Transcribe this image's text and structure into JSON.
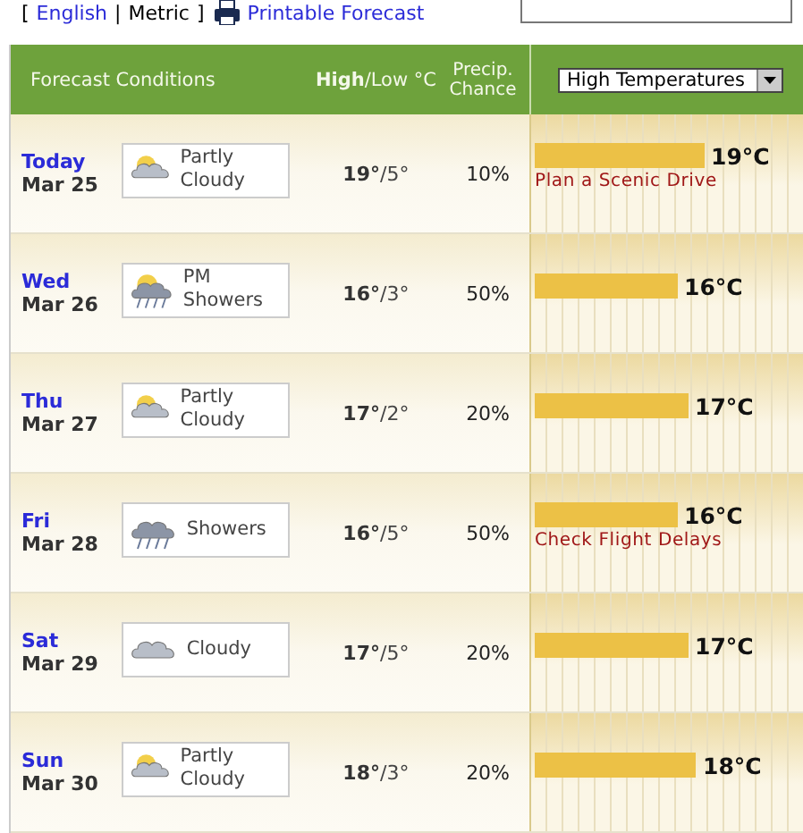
{
  "top_bar": {
    "open_bracket": "[",
    "units": [
      {
        "label": "English",
        "selected": false
      },
      {
        "label": "Metric",
        "selected": true
      }
    ],
    "separator": "|",
    "close_bracket": "]",
    "print_link": "Printable Forecast"
  },
  "header": {
    "conditions": "Forecast Conditions",
    "temps": "**High**/Low °C",
    "precip": "Precip. Chance",
    "chart_select": "High Temperatures"
  },
  "days": [
    {
      "day": "Today",
      "date": "Mar 25",
      "kind": "partly-cloudy",
      "condition": "Partly Cloudy",
      "high": "19°",
      "low": "/5°",
      "precip": "10%",
      "level": 0.63,
      "reading": "19°C",
      "note": "Plan a Scenic Drive"
    },
    {
      "day": "Wed",
      "date": "Mar 26",
      "kind": "showers",
      "condition": "PM Showers",
      "high": "16°",
      "low": "/3°",
      "precip": "50%",
      "level": 0.53,
      "reading": "16°C"
    },
    {
      "day": "Thu",
      "date": "Mar 27",
      "kind": "partly-cloudy",
      "condition": "Partly Cloudy",
      "high": "17°",
      "low": "/2°",
      "precip": "20%",
      "level": 0.57,
      "reading": "17°C"
    },
    {
      "day": "Fri",
      "date": "Mar 28",
      "kind": "showers",
      "condition": "Showers",
      "high": "16°",
      "low": "/5°",
      "precip": "50%",
      "level": 0.53,
      "reading": "16°C",
      "note": "Check Flight Delays"
    },
    {
      "day": "Sat",
      "date": "Mar 29",
      "kind": "cloudy",
      "condition": "Cloudy",
      "high": "17°",
      "low": "/5°",
      "precip": "20%",
      "level": 0.57,
      "reading": "17°C"
    },
    {
      "day": "Sun",
      "date": "Mar 30",
      "kind": "partly-cloudy",
      "condition": "Partly Cloudy",
      "high": "18°",
      "low": "/3°",
      "precip": "20%",
      "level": 0.6,
      "reading": "18°C"
    }
  ]
}
